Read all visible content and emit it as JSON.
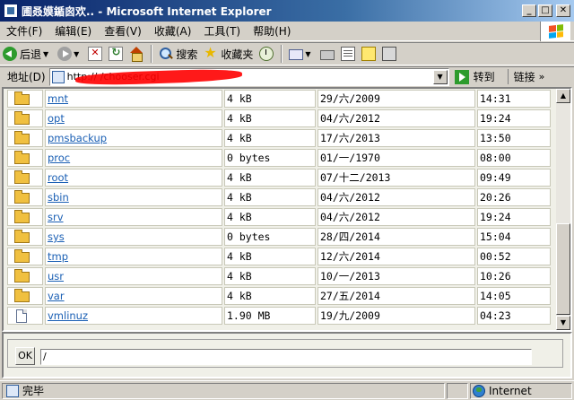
{
  "window": {
    "title": "圃叒嫫鍎囪欢.. - Microsoft Internet Explorer",
    "minimize": "_",
    "maximize": "□",
    "close": "✕"
  },
  "menu": [
    "文件(F)",
    "编辑(E)",
    "查看(V)",
    "收藏(A)",
    "工具(T)",
    "帮助(H)"
  ],
  "toolbar": {
    "back": "后退",
    "search": "搜索",
    "favorites": "收藏夹"
  },
  "address": {
    "label": "地址(D)",
    "url": "http://                                     /chooser.cgi",
    "go": "转到",
    "links": "链接",
    "links_more": "»"
  },
  "files": [
    {
      "type": "folder",
      "name": "mnt",
      "size": "4 kB",
      "date": "29/六/2009",
      "time": "14:31"
    },
    {
      "type": "folder",
      "name": "opt",
      "size": "4 kB",
      "date": "04/六/2012",
      "time": "19:24"
    },
    {
      "type": "folder",
      "name": "pmsbackup",
      "size": "4 kB",
      "date": "17/六/2013",
      "time": "13:50"
    },
    {
      "type": "folder",
      "name": "proc",
      "size": "0 bytes",
      "date": "01/一/1970",
      "time": "08:00"
    },
    {
      "type": "folder",
      "name": "root",
      "size": "4 kB",
      "date": "07/十二/2013",
      "time": "09:49"
    },
    {
      "type": "folder",
      "name": "sbin",
      "size": "4 kB",
      "date": "04/六/2012",
      "time": "20:26"
    },
    {
      "type": "folder",
      "name": "srv",
      "size": "4 kB",
      "date": "04/六/2012",
      "time": "19:24"
    },
    {
      "type": "folder",
      "name": "sys",
      "size": "0 bytes",
      "date": "28/四/2014",
      "time": "15:04"
    },
    {
      "type": "folder",
      "name": "tmp",
      "size": "4 kB",
      "date": "12/六/2014",
      "time": "00:52"
    },
    {
      "type": "folder",
      "name": "usr",
      "size": "4 kB",
      "date": "10/一/2013",
      "time": "10:26"
    },
    {
      "type": "folder",
      "name": "var",
      "size": "4 kB",
      "date": "27/五/2014",
      "time": "14:05"
    },
    {
      "type": "file",
      "name": "vmlinuz",
      "size": "1.90 MB",
      "date": "19/九/2009",
      "time": "04:23"
    }
  ],
  "chooser": {
    "ok": "OK",
    "path": "/"
  },
  "status": {
    "text": "完毕",
    "zone": "Internet"
  }
}
